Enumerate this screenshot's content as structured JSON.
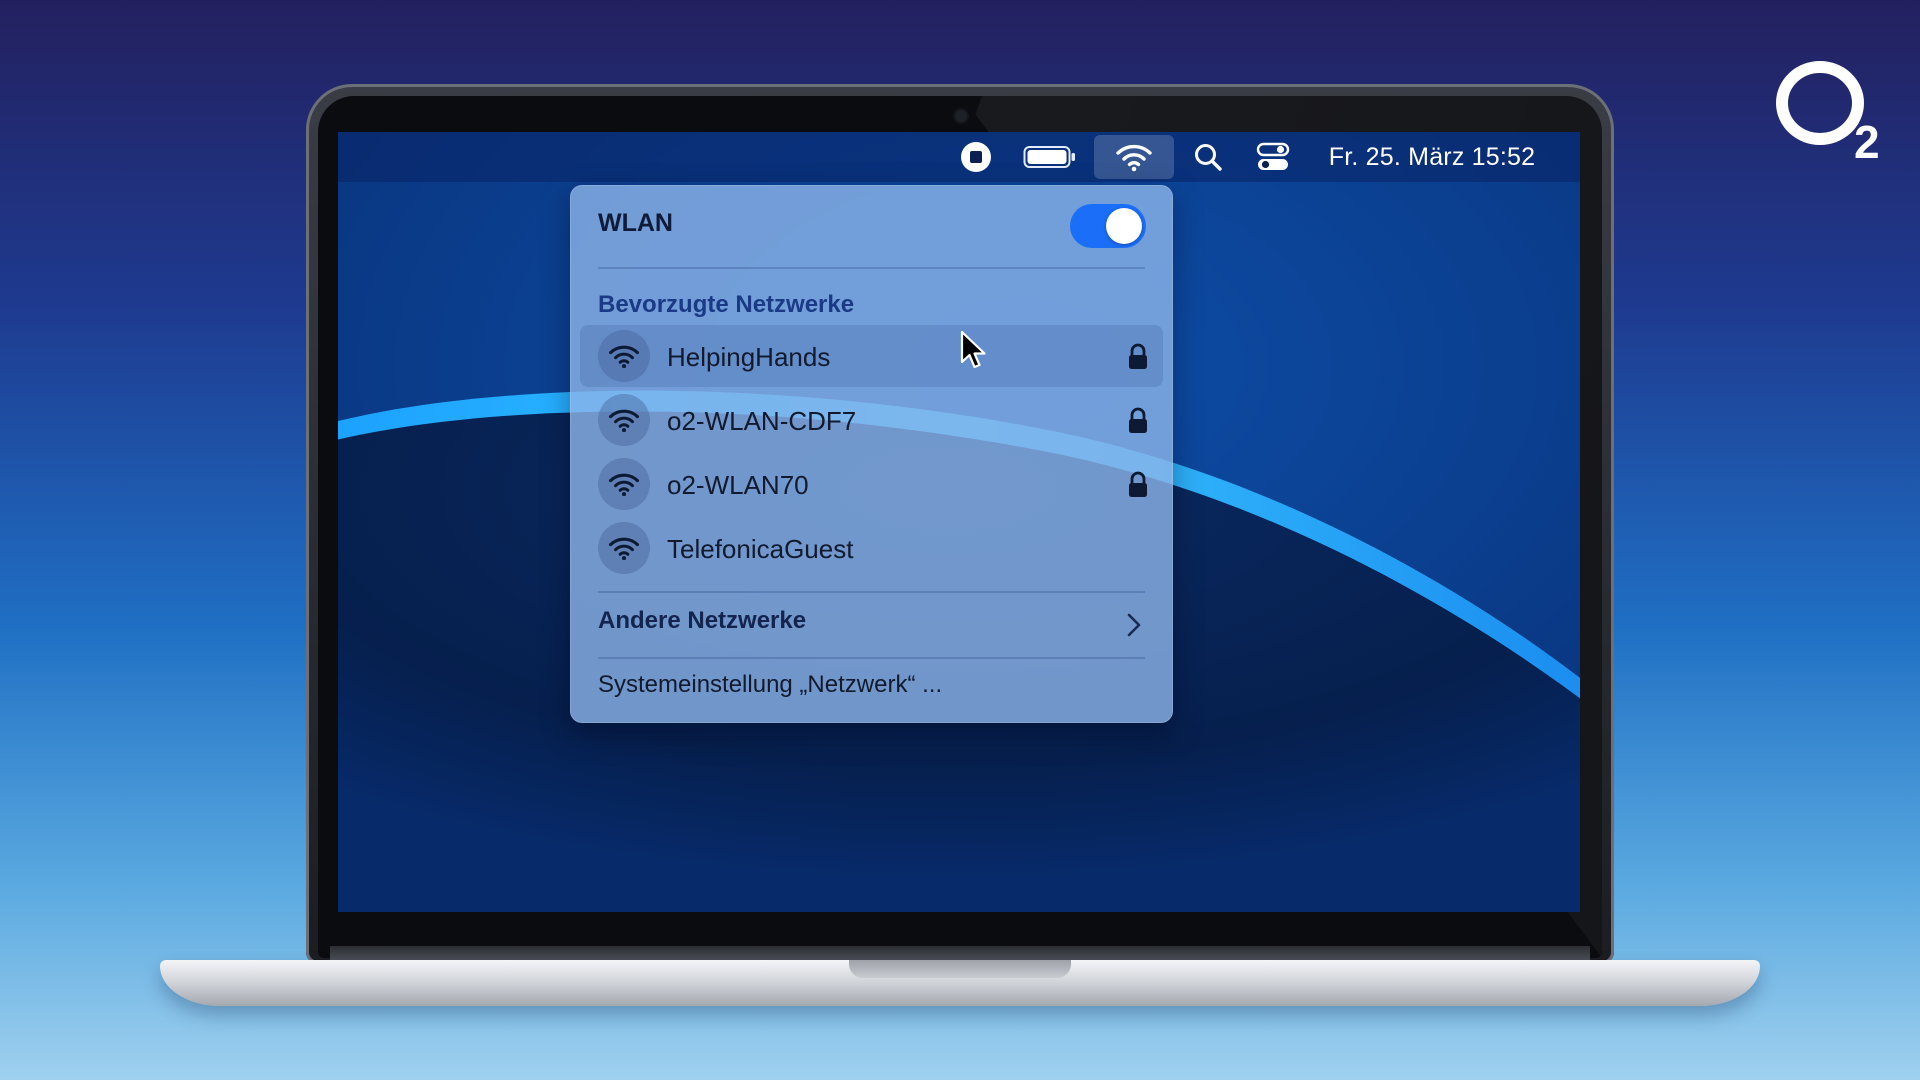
{
  "brand": {
    "logo_letter": "O",
    "logo_subscript": "2"
  },
  "menubar": {
    "icons": [
      "stop-record-icon",
      "battery-icon",
      "wifi-icon",
      "search-icon",
      "control-center-icon"
    ],
    "clock": "Fr. 25. März 15:52"
  },
  "wifi_menu": {
    "title": "WLAN",
    "toggle_on": true,
    "preferred_header": "Bevorzugte Netzwerke",
    "networks": [
      {
        "name": "HelpingHands",
        "locked": true,
        "highlighted": true
      },
      {
        "name": "o2-WLAN-CDF7",
        "locked": true,
        "highlighted": false
      },
      {
        "name": "o2-WLAN70",
        "locked": true,
        "highlighted": false
      },
      {
        "name": "TelefonicaGuest",
        "locked": false,
        "highlighted": false
      }
    ],
    "other_networks": "Andere Netzwerke",
    "settings_link": "Systemeinstellung „Netzwerk“ ..."
  },
  "colors": {
    "toggle_on": "#1a6ef7",
    "panel_bg": "#8cb4e8",
    "section_header": "#1a3a86"
  }
}
